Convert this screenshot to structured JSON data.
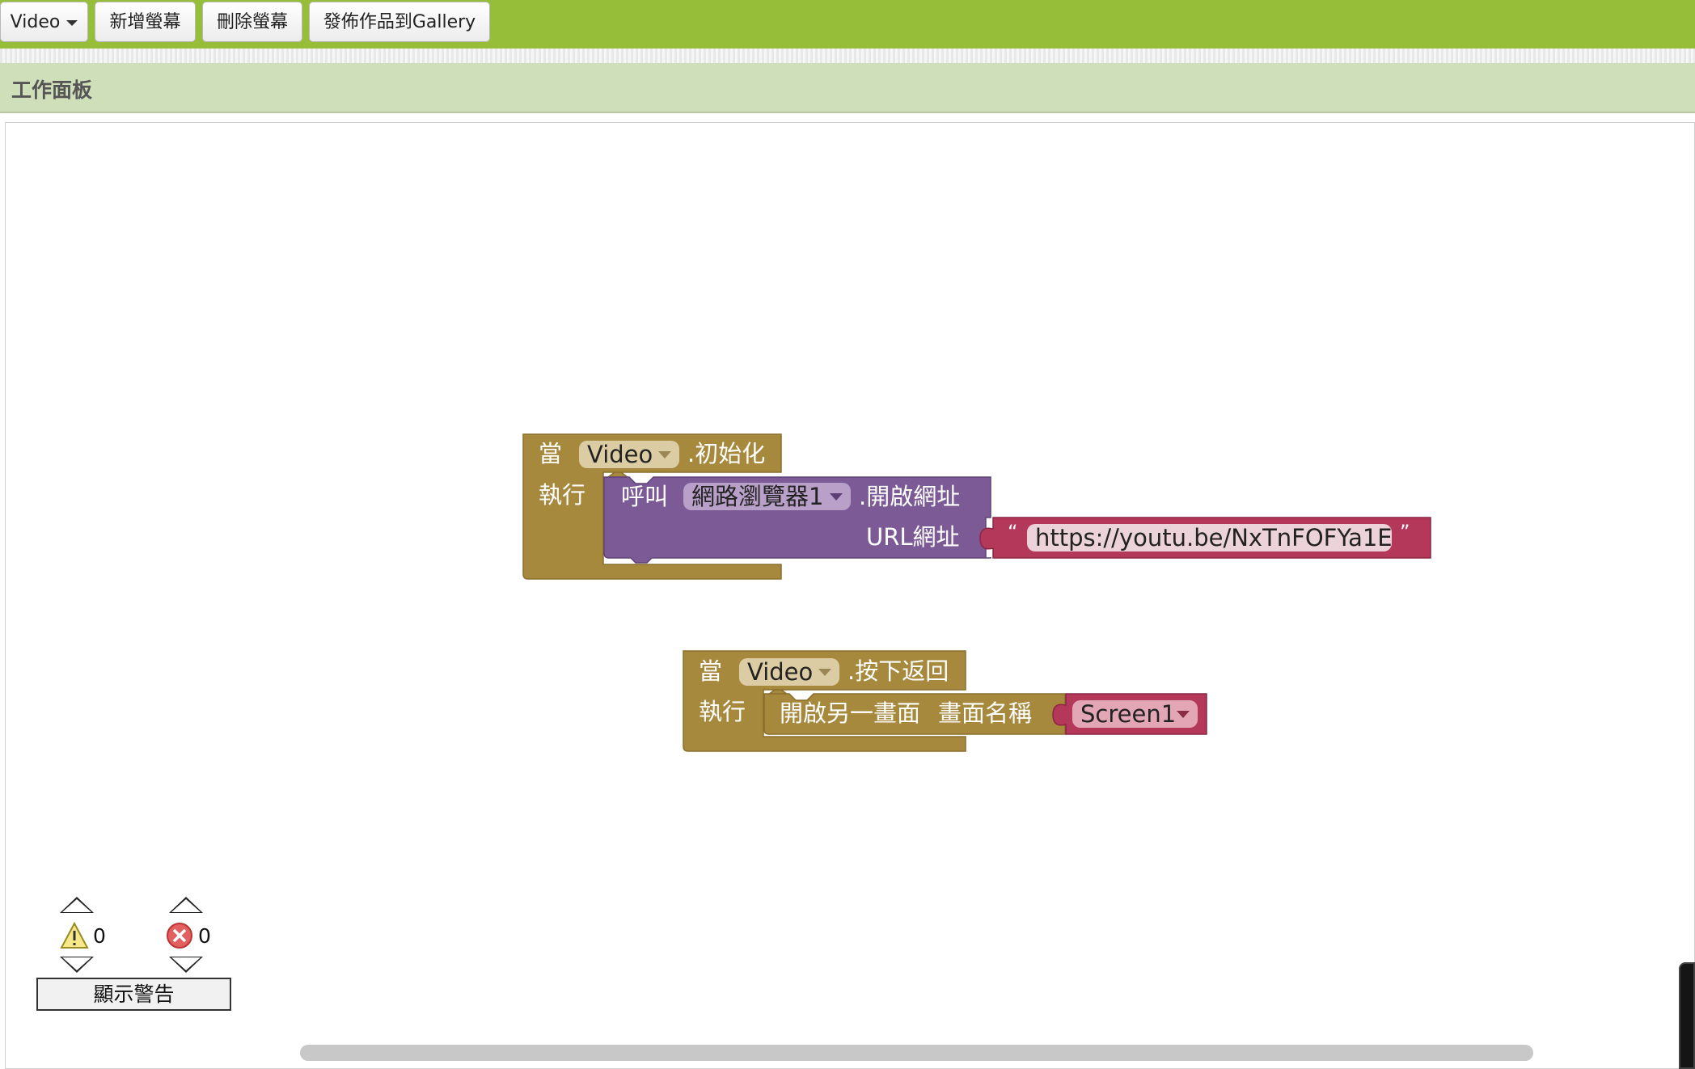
{
  "toolbar": {
    "screen_select": "Video",
    "add_screen": "新增螢幕",
    "remove_screen": "刪除螢幕",
    "publish_gallery": "發佈作品到Gallery"
  },
  "panel": {
    "title": "工作面板"
  },
  "blocks": {
    "init_event": {
      "when": "當",
      "component": "Video",
      "event": ".初始化",
      "do": "執行",
      "call": "呼叫",
      "call_component": "網路瀏覽器1",
      "method": ".開啟網址",
      "param_label": "URL網址",
      "open_quote": "“",
      "url": "https://youtu.be/NxTnFOFYa1E",
      "close_quote": "”"
    },
    "back_event": {
      "when": "當",
      "component": "Video",
      "event": ".按下返回",
      "do": "執行",
      "open_screen": "開啟另一畫面",
      "screen_name_label": "畫面名稱",
      "screen_value": "Screen1"
    }
  },
  "indicator": {
    "warning_count": "0",
    "error_count": "0",
    "show_warnings": "顯示警告"
  },
  "colors": {
    "toolbar": "#97be38",
    "panel_header": "#cfdfba",
    "event_block": "#a7893d",
    "procedure_block": "#7c5a96",
    "text_block": "#b3385a"
  }
}
